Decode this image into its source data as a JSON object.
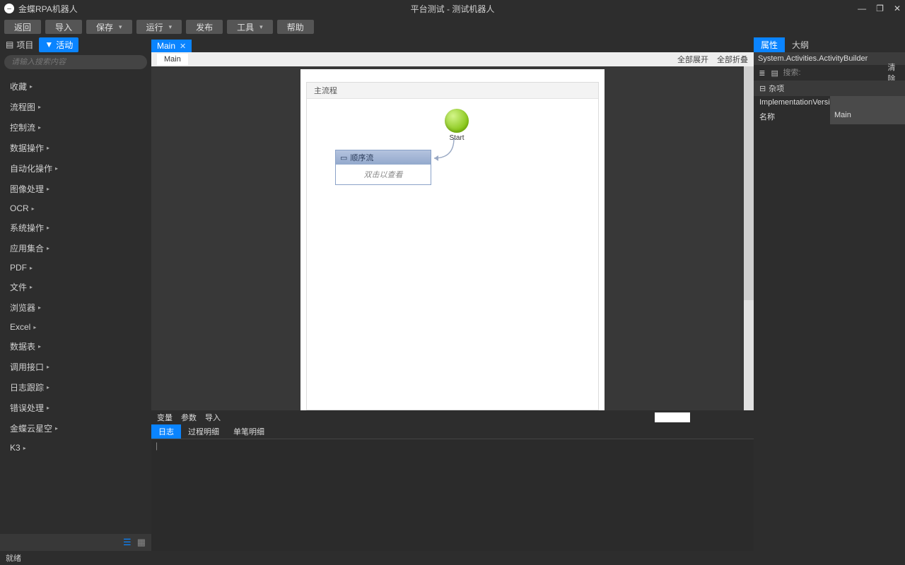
{
  "app": {
    "name": "金蝶RPA机器人",
    "title": "平台测试 - 测试机器人"
  },
  "toolbar": {
    "back": "返回",
    "import": "导入",
    "save": "保存",
    "run": "运行",
    "publish": "发布",
    "tools": "工具",
    "help": "帮助"
  },
  "left": {
    "tab_project": "项目",
    "tab_activity": "活动",
    "search_placeholder": "请输入搜索内容",
    "categories": [
      "收藏",
      "流程图",
      "控制流",
      "数据操作",
      "自动化操作",
      "图像处理",
      "OCR",
      "系统操作",
      "应用集合",
      "PDF",
      "文件",
      "浏览器",
      "Excel",
      "数据表",
      "调用接口",
      "日志跟踪",
      "错误处理",
      "金蝶云星空",
      "K3"
    ]
  },
  "center": {
    "file_tab": "Main",
    "sub_tab": "Main",
    "expand_all": "全部展开",
    "collapse_all": "全部折叠",
    "flow_title": "主流程",
    "start_label": "Start",
    "seq_title": "顺序流",
    "seq_hint": "双击以查看",
    "strip": {
      "var": "变量",
      "param": "参数",
      "import": "导入"
    },
    "log_tabs": {
      "log": "日志",
      "process": "过程明细",
      "single": "单笔明细"
    }
  },
  "right": {
    "tab_prop": "属性",
    "tab_outline": "大纲",
    "type": "System.Activities.ActivityBuilder",
    "search_placeholder": "搜索:",
    "clear": "清除",
    "group": "杂项",
    "rows": [
      {
        "k": "ImplementationVersion",
        "v": ""
      },
      {
        "k": "名称",
        "v": "Main"
      }
    ]
  },
  "status": "就绪"
}
